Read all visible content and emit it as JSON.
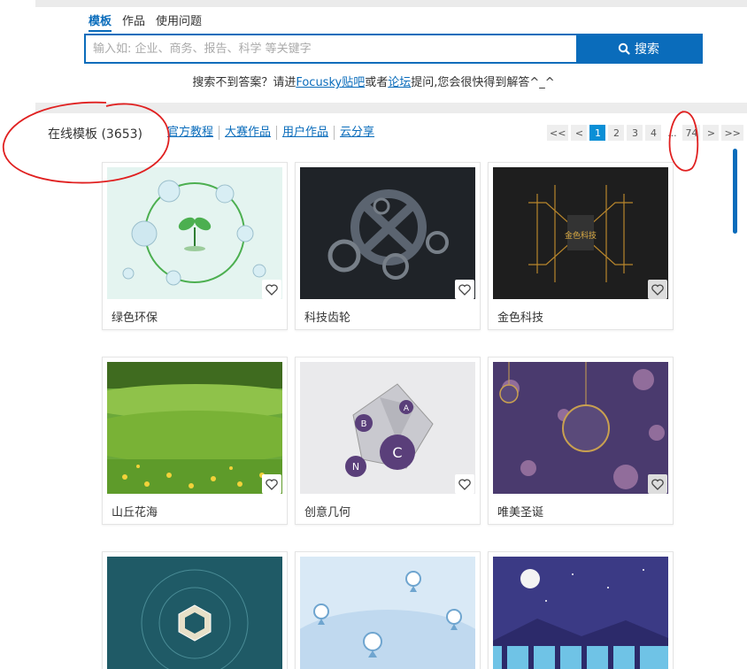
{
  "search": {
    "tabs": [
      "模板",
      "作品",
      "使用问题"
    ],
    "placeholder": "输入如: 企业、商务、报告、科学 等关键字",
    "button_label": "搜索"
  },
  "help": {
    "prefix": "搜索不到答案？请进",
    "link1": "Focusky贴吧",
    "middle": "或者",
    "link2": "论坛",
    "suffix": "提问,您会很快得到解答^_^"
  },
  "section": {
    "title": "在线模板 (3653)",
    "categories": [
      "官方教程",
      "大赛作品",
      "用户作品",
      "云分享"
    ]
  },
  "pager": {
    "first": "<<",
    "prev": "<",
    "pages": [
      "1",
      "2",
      "3",
      "4"
    ],
    "dots": "...",
    "last_page": "74",
    "next": ">",
    "end": ">>",
    "current": "1"
  },
  "templates": [
    {
      "title": "绿色环保",
      "icon": "leaf-bubbles"
    },
    {
      "title": "科技齿轮",
      "icon": "gears"
    },
    {
      "title": "金色科技",
      "icon": "golden-circuit",
      "thumb_text": "金色科技"
    },
    {
      "title": "山丘花海",
      "icon": "hill-flowers"
    },
    {
      "title": "创意几何",
      "icon": "geometry",
      "thumb_labels": [
        "A",
        "B",
        "C",
        "N"
      ]
    },
    {
      "title": "唯美圣诞",
      "icon": "christmas-ornaments"
    },
    {
      "title": "",
      "icon": "tech-hexagon"
    },
    {
      "title": "",
      "icon": "map-pins"
    },
    {
      "title": "",
      "icon": "night-bridge"
    }
  ],
  "colors": {
    "accent": "#0a6cbb",
    "pager_active": "#0a8fd6",
    "annotation": "#e02020"
  }
}
